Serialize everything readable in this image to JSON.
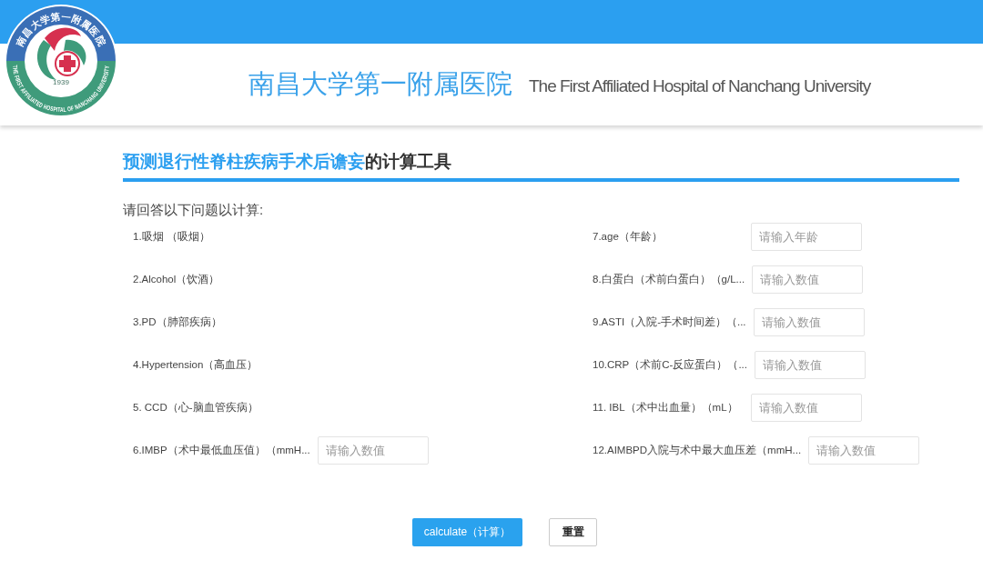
{
  "logo": {
    "top_text": "南昌大学第一附属医院",
    "bottom_text": "THE FIRST AFFILIATED HOSPITAL OF NANCHANG UNIVERSITY",
    "year": "1939"
  },
  "header": {
    "title_cn": "南昌大学第一附属医院",
    "title_en": "The First Affiliated Hospital of Nanchang University"
  },
  "page_title": {
    "highlight": "预测退行性脊柱疾病手术后谵妄",
    "rest": "的计算工具"
  },
  "instruction": "请回答以下问题以计算:",
  "left_questions": [
    {
      "label": "1.吸烟 （吸烟）",
      "kind": "plain"
    },
    {
      "label": "2.Alcohol（饮酒）",
      "kind": "plain"
    },
    {
      "label": "3.PD（肺部疾病）",
      "kind": "plain"
    },
    {
      "label": "4.Hypertension（高血压）",
      "kind": "plain"
    },
    {
      "label": "5. CCD（心-脑血管疾病）",
      "kind": "plain"
    },
    {
      "label": "6.IMBP（术中最低血压值）（mmH...",
      "kind": "input",
      "placeholder": "请输入数值"
    }
  ],
  "right_questions": [
    {
      "label": "7.age（年龄）",
      "kind": "input",
      "placeholder": "请输入年龄"
    },
    {
      "label": "8.白蛋白（术前白蛋白）（g/L...",
      "kind": "input",
      "placeholder": "请输入数值"
    },
    {
      "label": "9.ASTI（入院-手术时间差）（...",
      "kind": "input",
      "placeholder": "请输入数值"
    },
    {
      "label": "10.CRP（术前C-反应蛋白）（...",
      "kind": "input",
      "placeholder": "请输入数值"
    },
    {
      "label": "11. IBL（术中出血量）（mL）",
      "kind": "input",
      "placeholder": "请输入数值"
    },
    {
      "label": "12.AIMBPD入院与术中最大血压差（mmH...",
      "kind": "input",
      "placeholder": "请输入数值"
    }
  ],
  "buttons": [
    {
      "label": "calculate（计算）",
      "kind": "primary"
    },
    {
      "label": "重置",
      "kind": "secondary"
    }
  ]
}
